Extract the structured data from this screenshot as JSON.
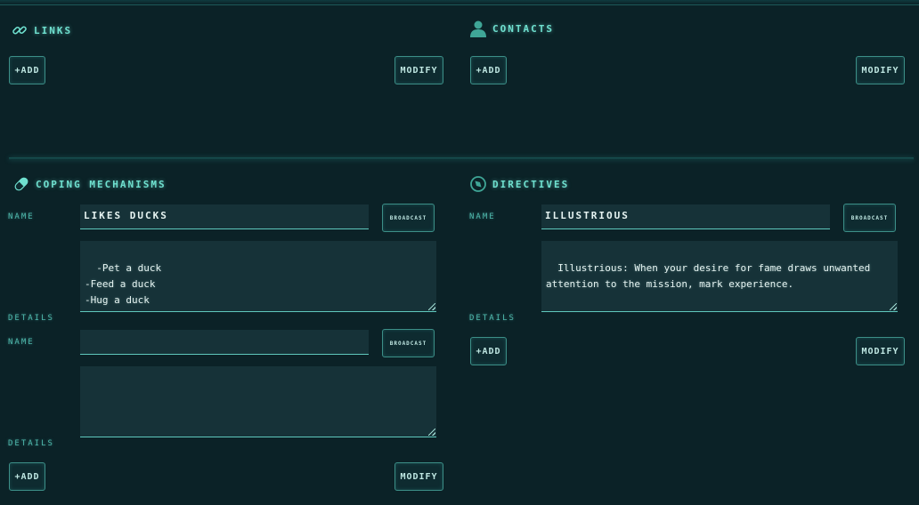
{
  "links": {
    "title": "LINKS",
    "icon": "link-icon",
    "add_label": "+ADD",
    "modify_label": "MODIFY"
  },
  "contacts": {
    "title": "CONTACTS",
    "icon": "person-icon",
    "add_label": "+ADD",
    "modify_label": "MODIFY"
  },
  "coping": {
    "title": "COPING MECHANISMS",
    "icon": "pill-icon",
    "entries": [
      {
        "name_label": "NAME",
        "name_value": "LIKES DUCKS",
        "broadcast_label": "BROADCAST",
        "details_label": "DETAILS",
        "details_value": "-Pet a duck\n-Feed a duck\n-Hug a duck"
      },
      {
        "name_label": "NAME",
        "name_value": "",
        "broadcast_label": "BROADCAST",
        "details_label": "DETAILS",
        "details_value": ""
      }
    ],
    "add_label": "+ADD",
    "modify_label": "MODIFY"
  },
  "directives": {
    "title": "DIRECTIVES",
    "icon": "compass-icon",
    "entries": [
      {
        "name_label": "NAME",
        "name_value": "ILLUSTRIOUS",
        "broadcast_label": "BROADCAST",
        "details_label": "DETAILS",
        "details_value": "Illustrious: When your desire for fame draws unwanted attention to the mission, mark experience."
      }
    ],
    "add_label": "+ADD",
    "modify_label": "MODIFY"
  },
  "colors": {
    "background": "#0b2227",
    "accent": "#6fe0cf",
    "field": "#163238",
    "border": "#3c8f88"
  }
}
